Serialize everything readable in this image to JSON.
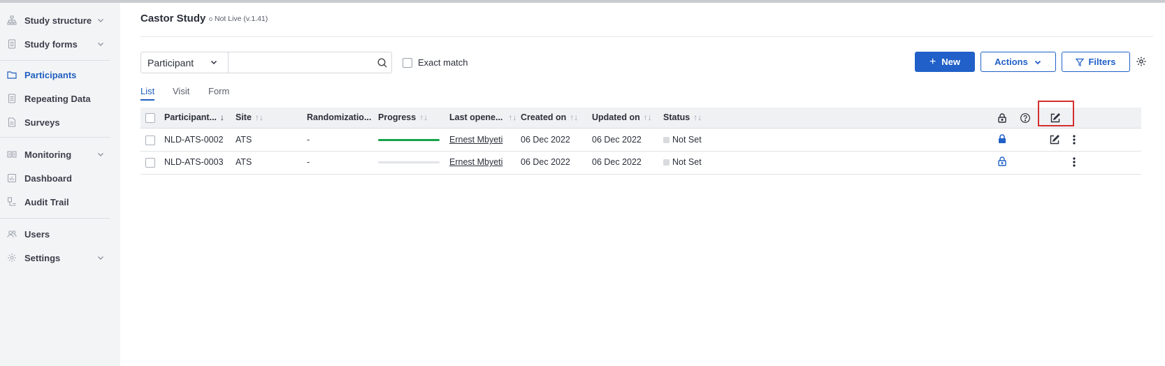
{
  "sidebar": {
    "items": [
      {
        "label": "Study structure",
        "icon": "sitemap-icon",
        "chevron": true
      },
      {
        "label": "Study forms",
        "icon": "document-icon",
        "chevron": true
      },
      {
        "label": "Participants",
        "icon": "folder-icon",
        "active": true
      },
      {
        "label": "Repeating Data",
        "icon": "document-icon"
      },
      {
        "label": "Surveys",
        "icon": "document-icon"
      },
      {
        "label": "Monitoring",
        "icon": "monitoring-icon",
        "chevron": true
      },
      {
        "label": "Dashboard",
        "icon": "chart-icon"
      },
      {
        "label": "Audit Trail",
        "icon": "audit-icon"
      },
      {
        "label": "Users",
        "icon": "users-icon"
      },
      {
        "label": "Settings",
        "icon": "gear-icon",
        "chevron": true
      }
    ]
  },
  "header": {
    "title": "Castor Study",
    "live_status": "Not Live (v.1.41)"
  },
  "toolbar": {
    "select_value": "Participant",
    "search_value": "",
    "exact_match_label": "Exact match",
    "new_label": "New",
    "actions_label": "Actions",
    "filters_label": "Filters"
  },
  "tabs": [
    {
      "label": "List",
      "active": true
    },
    {
      "label": "Visit"
    },
    {
      "label": "Form"
    }
  ],
  "table": {
    "columns": [
      "Participant...",
      "Site",
      "Randomizatio...",
      "Progress",
      "Last opene...",
      "Created on",
      "Updated on",
      "Status"
    ],
    "rows": [
      {
        "participant": "NLD-ATS-0002",
        "site": "ATS",
        "randomization": "-",
        "progress": 1.0,
        "last_opened": "Ernest Mbyeti",
        "created": "06 Dec 2022",
        "updated": "06 Dec 2022",
        "status": "Not Set",
        "locked": true,
        "editable": true
      },
      {
        "participant": "NLD-ATS-0003",
        "site": "ATS",
        "randomization": "-",
        "progress": 0.0,
        "last_opened": "Ernest Mbyeti",
        "created": "06 Dec 2022",
        "updated": "06 Dec 2022",
        "status": "Not Set",
        "locked": false,
        "editable": false
      }
    ]
  },
  "colors": {
    "accent": "#2060c8",
    "progress_complete": "#16a34a",
    "progress_empty": "#e2e3ea",
    "highlight": "#d32f2f"
  }
}
